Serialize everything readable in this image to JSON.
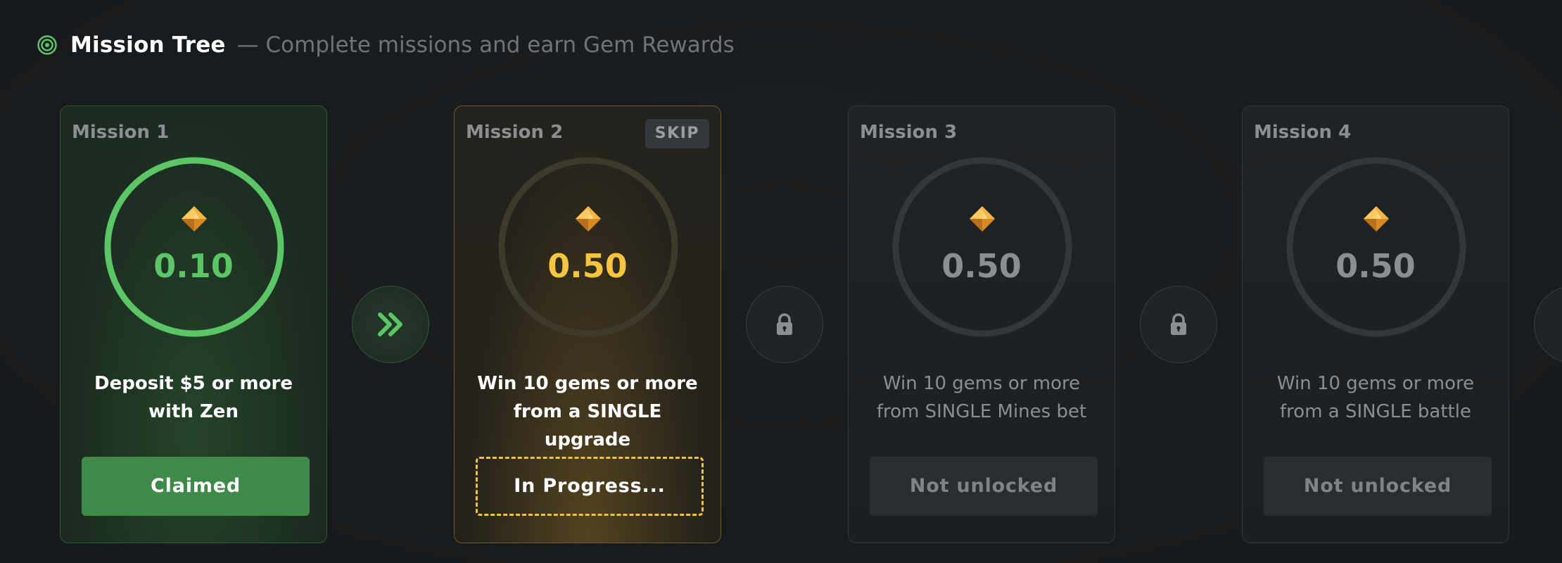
{
  "header": {
    "title": "Mission Tree",
    "subtitle": "— Complete missions and earn Gem Rewards",
    "icon": "target-icon"
  },
  "colors": {
    "claimed_green": "#5cc566",
    "claimed_button": "#3f8a48",
    "progress_gold": "#f5c542",
    "locked_gray": "#8b8f92"
  },
  "missions": [
    {
      "label": "Mission 1",
      "reward": "0.10",
      "description": "Deposit $5 or more with Zen",
      "action": "Claimed",
      "status": "claimed",
      "progress": 1.0
    },
    {
      "label": "Mission 2",
      "reward": "0.50",
      "description": "Win 10 gems or more from a SINGLE upgrade",
      "action": "In Progress...",
      "status": "in-progress",
      "skip_label": "SKIP",
      "progress": 0
    },
    {
      "label": "Mission 3",
      "reward": "0.50",
      "description": "Win 10 gems or more from SINGLE Mines bet",
      "action": "Not unlocked",
      "status": "locked",
      "progress": 0
    },
    {
      "label": "Mission 4",
      "reward": "0.50",
      "description": "Win 10 gems or more from a SINGLE battle",
      "action": "Not unlocked",
      "status": "locked",
      "progress": 0
    }
  ],
  "connectors": [
    {
      "icon": "double-chevron-right-icon",
      "status": "active"
    },
    {
      "icon": "lock-icon",
      "status": "locked"
    },
    {
      "icon": "lock-icon",
      "status": "locked"
    }
  ]
}
